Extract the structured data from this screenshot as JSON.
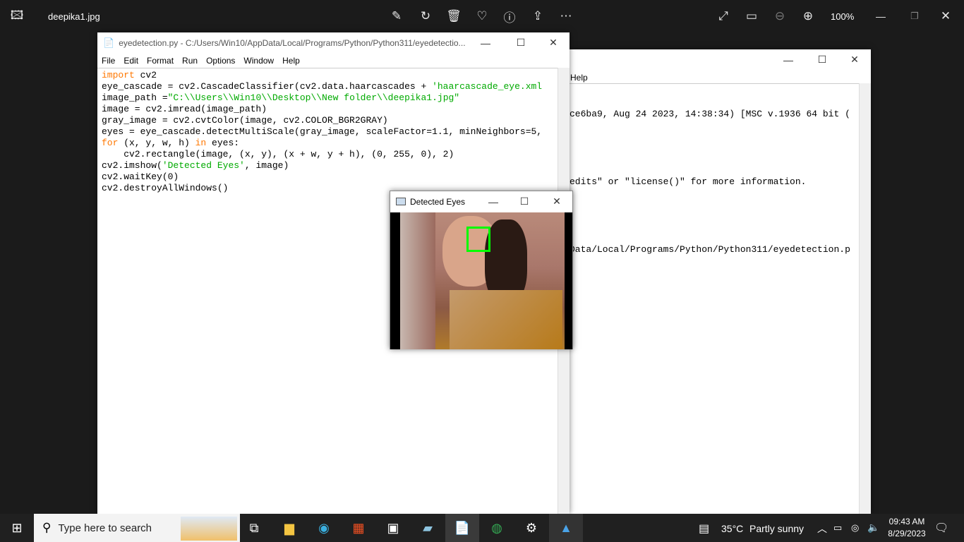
{
  "photos": {
    "title": "deepika1.jpg",
    "zoom": "100%",
    "icons": [
      "photos-app-icon",
      "edit-icon",
      "rotate-icon",
      "delete-icon",
      "favorite-icon",
      "info-icon",
      "share-icon",
      "more-icon",
      "fullscreen-icon",
      "fit-icon",
      "zoom-out-icon",
      "zoom-in-icon"
    ]
  },
  "editor": {
    "title": "eyedetection.py - C:/Users/Win10/AppData/Local/Programs/Python/Python311/eyedetectio...",
    "menu": [
      "File",
      "Edit",
      "Format",
      "Run",
      "Options",
      "Window",
      "Help"
    ],
    "code": [
      [
        [
          "kw",
          "import"
        ],
        [
          "",
          "cv2"
        ]
      ],
      [
        [
          "",
          "eye_cascade = cv2.CascadeClassifier(cv2.data.haarcascades + "
        ],
        [
          "st",
          "'haarcascade_eye.xml"
        ]
      ],
      [
        [
          "",
          "image_path ="
        ],
        [
          "st",
          "\"C:\\\\Users\\\\Win10\\\\Desktop\\\\New folder\\\\deepika1.jpg\""
        ]
      ],
      [
        [
          "",
          "image = cv2.imread(image_path)"
        ]
      ],
      [
        [
          "",
          "gray_image = cv2.cvtColor(image, cv2.COLOR_BGR2GRAY)"
        ]
      ],
      [
        [
          "",
          "eyes = eye_cascade.detectMultiScale(gray_image, scaleFactor=1.1, minNeighbors=5,"
        ]
      ],
      [
        [
          "kw",
          "for"
        ],
        [
          "",
          " (x, y, w, h) "
        ],
        [
          "kw",
          "in"
        ],
        [
          "",
          ""
        ],
        [
          "",
          "eyes:"
        ]
      ],
      [
        [
          "",
          "    cv2.rectangle(image, (x, y), (x + w, y + h), (0, 255, 0), 2)"
        ]
      ],
      [
        [
          "",
          "cv2.imshow("
        ],
        [
          "st",
          "'Detected Eyes'"
        ],
        [
          "",
          ", image)"
        ]
      ],
      [
        [
          "",
          "cv2.waitKey(0)"
        ]
      ],
      [
        [
          "",
          "cv2.destroyAllWindows()"
        ]
      ]
    ]
  },
  "shell": {
    "menu": [
      "Help"
    ],
    "lines": [
      "ce6ba9, Aug 24 2023, 14:38:34) [MSC v.1936 64 bit (",
      "",
      "edits\" or \"license()\" for more information.",
      "",
      "Data/Local/Programs/Python/Python311/eyedetection.p"
    ]
  },
  "cv_window": {
    "title": "Detected Eyes"
  },
  "taskbar": {
    "search_placeholder": "Type here to search",
    "weather_temp": "35°C",
    "weather_text": "Partly sunny",
    "time": "09:43 AM",
    "date": "8/29/2023",
    "apps": [
      "task-view",
      "file-explorer",
      "edge",
      "store",
      "terminal",
      "notepad-app",
      "idle",
      "chrome",
      "settings",
      "photos"
    ]
  }
}
